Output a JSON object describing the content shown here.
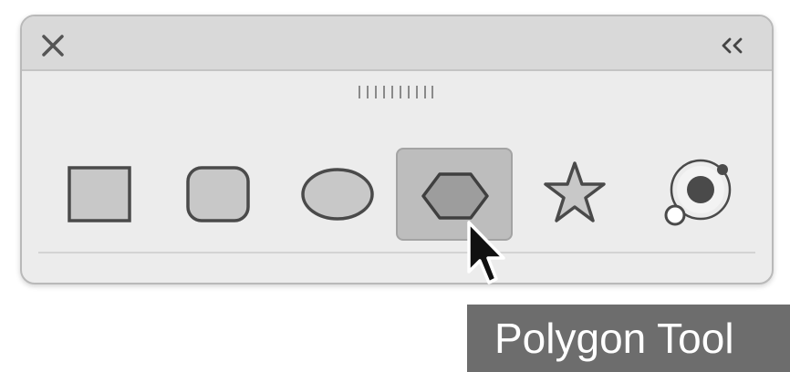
{
  "panel": {
    "close_icon": "close-icon",
    "collapse_icon": "double-chevron-left-icon",
    "grip_icon": "drag-handle-icon"
  },
  "tools": [
    {
      "name": "rectangle-tool",
      "icon": "rectangle-icon",
      "selected": false
    },
    {
      "name": "rounded-rectangle-tool",
      "icon": "rounded-rectangle-icon",
      "selected": false
    },
    {
      "name": "ellipse-tool",
      "icon": "ellipse-icon",
      "selected": false
    },
    {
      "name": "polygon-tool",
      "icon": "hexagon-icon",
      "selected": true
    },
    {
      "name": "star-tool",
      "icon": "star-icon",
      "selected": false
    },
    {
      "name": "flare-tool",
      "icon": "flare-icon",
      "selected": false
    }
  ],
  "tooltip": {
    "text": "Polygon Tool"
  },
  "colors": {
    "panel_bg": "#ececec",
    "titlebar_bg": "#d9d9d9",
    "selected_bg": "#bdbdbd",
    "tooltip_bg": "#6d6d6d",
    "icon_stroke": "#4a4a4a",
    "icon_fill": "#c8c8c8"
  }
}
